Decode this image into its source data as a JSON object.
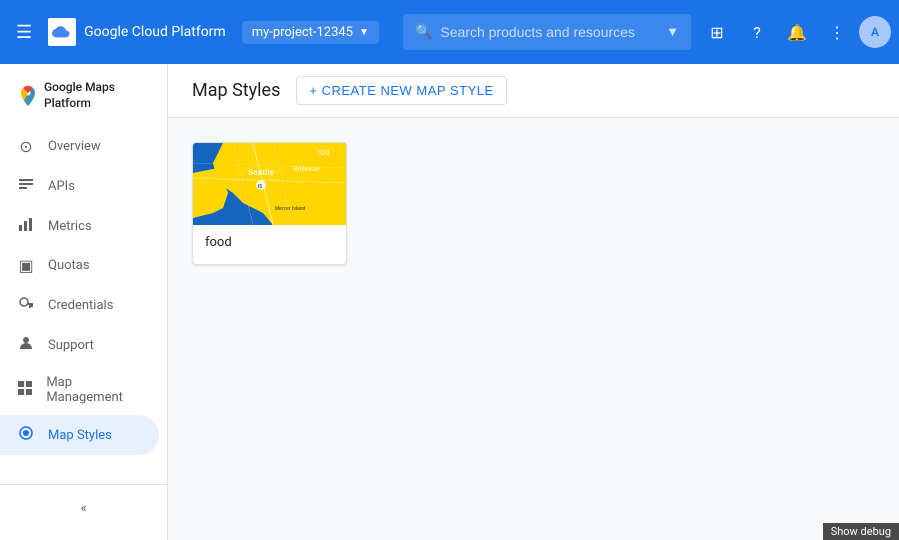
{
  "topbar": {
    "menu_icon": "☰",
    "app_name": "Google Cloud Platform",
    "project_name": "my-project-12345",
    "search_placeholder": "Search products and resources",
    "icons": {
      "console": "⊞",
      "help": "?",
      "notifications": "🔔",
      "more": "⋮"
    },
    "avatar_initials": "A"
  },
  "sidebar": {
    "brand_name": "Google Maps Platform",
    "items": [
      {
        "id": "overview",
        "label": "Overview",
        "icon": "⊙"
      },
      {
        "id": "apis",
        "label": "APIs",
        "icon": "☰"
      },
      {
        "id": "metrics",
        "label": "Metrics",
        "icon": "📊"
      },
      {
        "id": "quotas",
        "label": "Quotas",
        "icon": "▣"
      },
      {
        "id": "credentials",
        "label": "Credentials",
        "icon": "🔑"
      },
      {
        "id": "support",
        "label": "Support",
        "icon": "👤"
      },
      {
        "id": "map-management",
        "label": "Map Management",
        "icon": "▦"
      },
      {
        "id": "map-styles",
        "label": "Map Styles",
        "icon": "◎",
        "active": true
      }
    ],
    "collapse_icon": "«"
  },
  "main": {
    "title": "Map Styles",
    "create_button_label": "+ CREATE NEW MAP STYLE",
    "cards": [
      {
        "id": "food",
        "label": "food"
      }
    ]
  },
  "debug_bar": {
    "label": "Show debug"
  }
}
